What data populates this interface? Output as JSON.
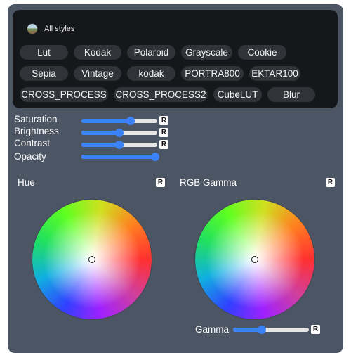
{
  "styles": {
    "title": "All styles",
    "chips": [
      "Lut",
      "Kodak",
      "Polaroid",
      "Grayscale",
      "Cookie",
      "Sepia",
      "Vintage",
      "kodak",
      "PORTRA800",
      "EKTAR100",
      "CROSS_PROCESS",
      "CROSS_PROCESS2",
      "CubeLUT",
      "Blur"
    ]
  },
  "sliders": [
    {
      "label": "Saturation",
      "value": 0.65,
      "reset_label": "R"
    },
    {
      "label": "Brightness",
      "value": 0.5,
      "reset_label": "R"
    },
    {
      "label": "Contrast",
      "value": 0.5,
      "reset_label": "R"
    },
    {
      "label": "Opacity",
      "value": 0.97
    }
  ],
  "hue": {
    "title": "Hue",
    "reset_label": "R"
  },
  "rgb_gamma": {
    "title": "RGB Gamma",
    "reset_label": "R"
  },
  "gamma": {
    "label": "Gamma",
    "value": 0.38,
    "reset_label": "R"
  },
  "colors": {
    "accent": "#3b82f6",
    "panel": "#4b5563",
    "styles_bg": "#16171b",
    "chip_bg": "#303338"
  },
  "icons": {
    "styles_avatar": "landscape-thumbnail-icon"
  }
}
